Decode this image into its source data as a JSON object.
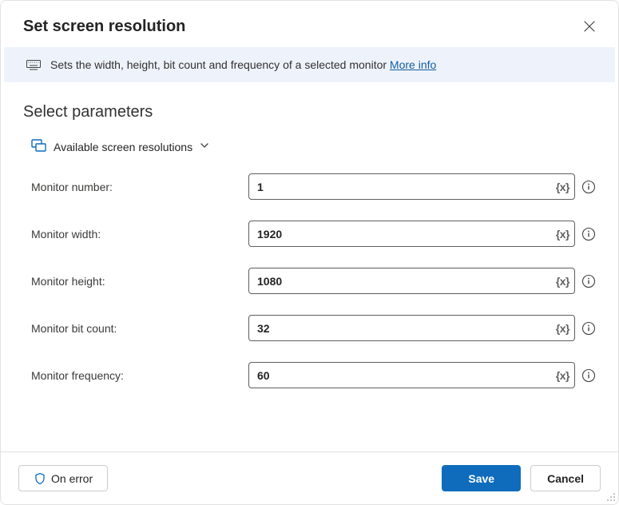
{
  "header": {
    "title": "Set screen resolution"
  },
  "info": {
    "text": "Sets the width, height, bit count and frequency of a selected monitor ",
    "link_label": "More info"
  },
  "section": {
    "title": "Select parameters",
    "resolutions_label": "Available screen resolutions"
  },
  "fields": {
    "monitor_number": {
      "label": "Monitor number:",
      "value": "1",
      "fx": "{x}"
    },
    "monitor_width": {
      "label": "Monitor width:",
      "value": "1920",
      "fx": "{x}"
    },
    "monitor_height": {
      "label": "Monitor height:",
      "value": "1080",
      "fx": "{x}"
    },
    "monitor_bit_count": {
      "label": "Monitor bit count:",
      "value": "32",
      "fx": "{x}"
    },
    "monitor_frequency": {
      "label": "Monitor frequency:",
      "value": "60",
      "fx": "{x}"
    }
  },
  "footer": {
    "on_error": "On error",
    "save": "Save",
    "cancel": "Cancel"
  }
}
